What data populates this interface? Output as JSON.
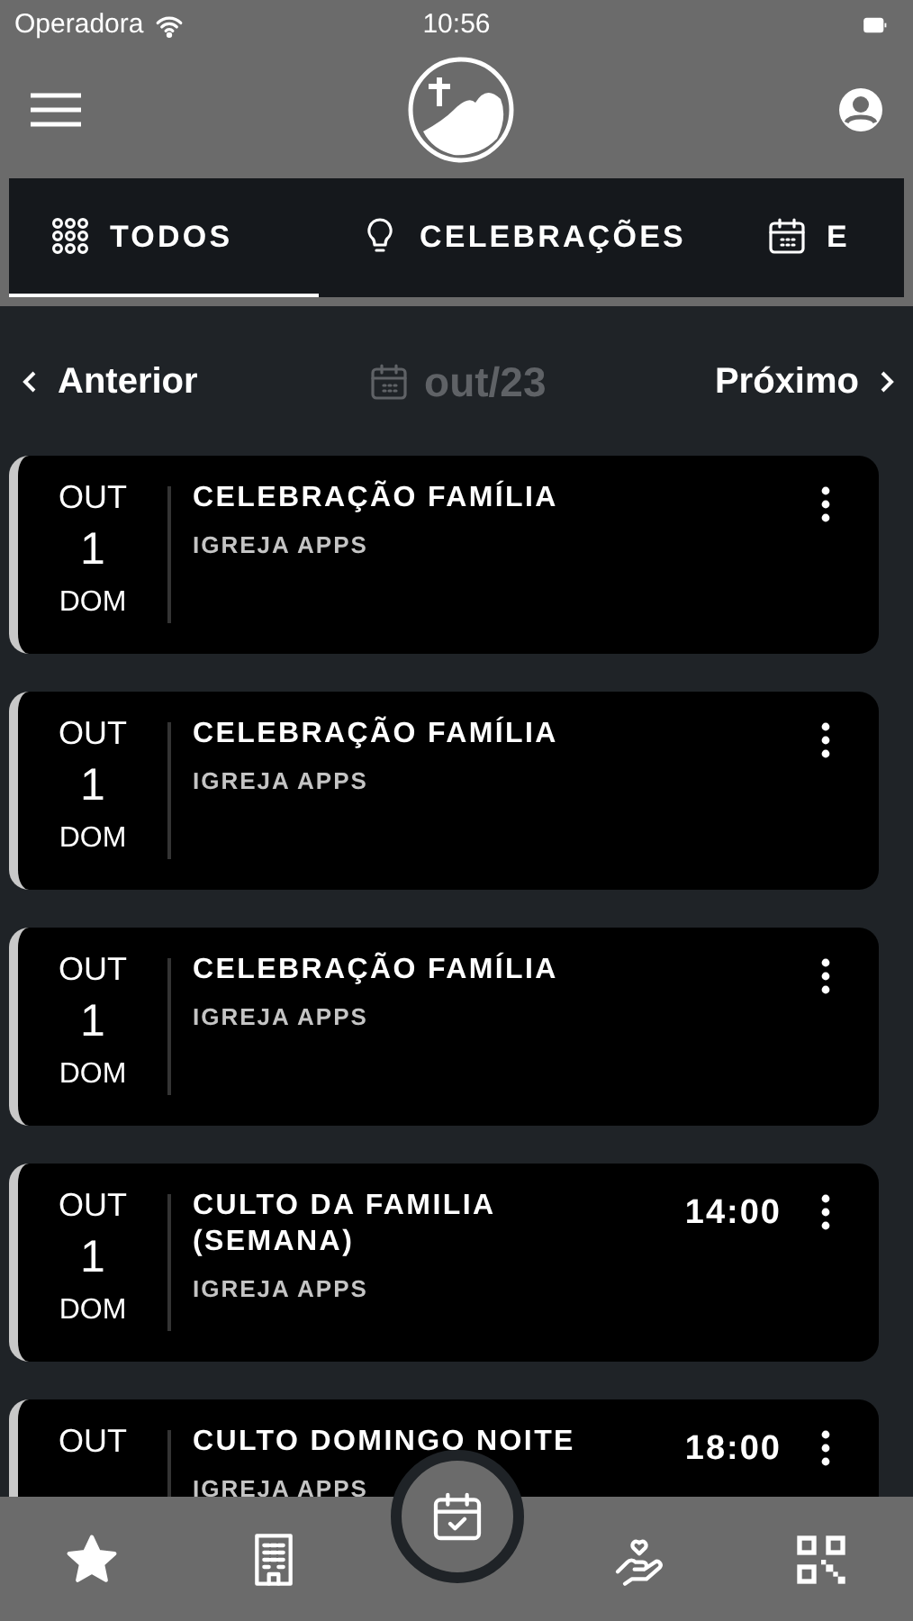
{
  "status_bar": {
    "carrier": "Operadora",
    "time": "10:56"
  },
  "tabs": [
    {
      "label": "TODOS",
      "selected": true
    },
    {
      "label": "CELEBRAÇÕES",
      "selected": false
    },
    {
      "label": "E",
      "selected": false
    }
  ],
  "month_nav": {
    "previous": "Anterior",
    "current": "out/23",
    "next": "Próximo"
  },
  "events": [
    {
      "month": "OUT",
      "day": "1",
      "weekday": "DOM",
      "title": "CELEBRAÇÃO FAMÍLIA",
      "organizer": "IGREJA APPS"
    },
    {
      "month": "OUT",
      "day": "1",
      "weekday": "DOM",
      "title": "CELEBRAÇÃO FAMÍLIA",
      "organizer": "IGREJA APPS"
    },
    {
      "month": "OUT",
      "day": "1",
      "weekday": "DOM",
      "title": "CELEBRAÇÃO FAMÍLIA",
      "organizer": "IGREJA APPS"
    },
    {
      "month": "OUT",
      "day": "1",
      "weekday": "DOM",
      "title": "CULTO DA FAMILIA (SEMANA)",
      "organizer": "IGREJA APPS",
      "time": "14:00"
    },
    {
      "month": "OUT",
      "title": "CULTO DOMINGO NOITE",
      "organizer": "IGREJA APPS",
      "time": "18:00"
    }
  ],
  "bottom_nav": [
    {
      "selected": false
    },
    {
      "selected": false
    },
    {
      "selected": true
    },
    {
      "selected": false
    },
    {
      "selected": false
    }
  ]
}
